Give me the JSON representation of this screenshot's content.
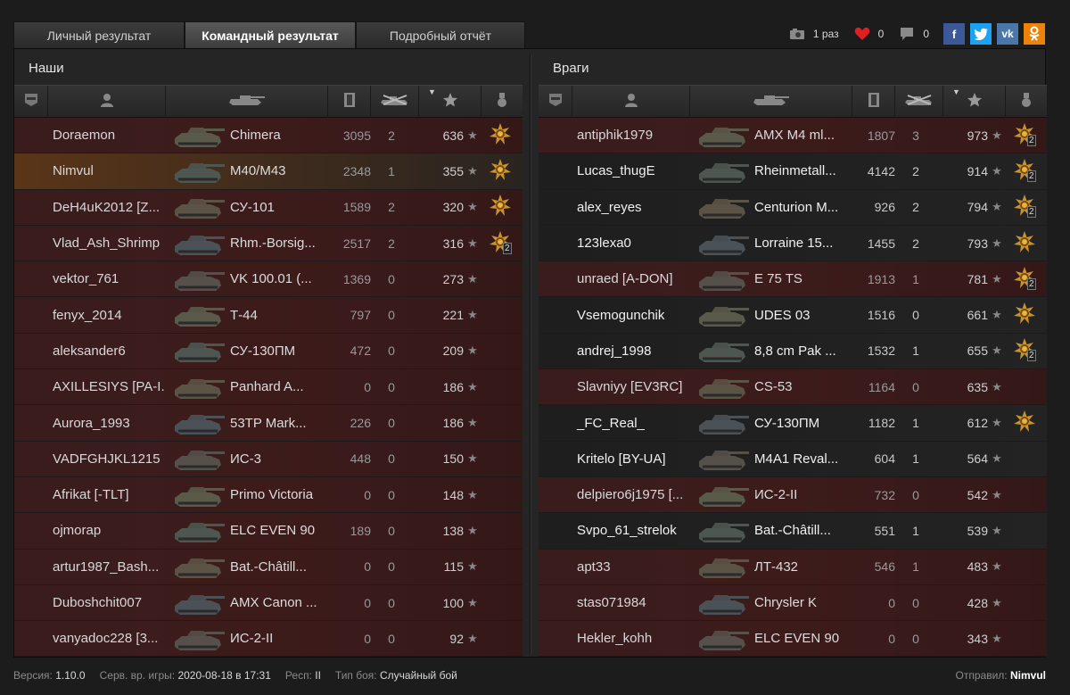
{
  "tabs": [
    {
      "label": "Личный результат",
      "active": false
    },
    {
      "label": "Командный результат",
      "active": true
    },
    {
      "label": "Подробный отчёт",
      "active": false
    }
  ],
  "social": {
    "views": "1 раз",
    "likes": "0",
    "comments": "0",
    "buttons": [
      "facebook",
      "twitter",
      "vk",
      "odnoklassniki"
    ],
    "colors": {
      "facebook": "#3b5998",
      "twitter": "#1da1f2",
      "vk": "#4a76a8",
      "odnoklassniki": "#ee8208"
    }
  },
  "teams": {
    "ours": {
      "title": "Наши",
      "players": [
        {
          "name": "Doraemon",
          "tank": "Chimera",
          "damage": "3095",
          "kills": "2",
          "xp": "636",
          "medal": true,
          "medal_count": "",
          "self": false,
          "alive": false
        },
        {
          "name": "Nimvul",
          "tank": "M40/M43",
          "damage": "2348",
          "kills": "1",
          "xp": "355",
          "medal": true,
          "medal_count": "",
          "self": true,
          "alive": false
        },
        {
          "name": "DeH4uK2012 [Z...",
          "tank": "СУ-101",
          "damage": "1589",
          "kills": "2",
          "xp": "320",
          "medal": true,
          "medal_count": "",
          "self": false,
          "alive": false
        },
        {
          "name": "Vlad_Ash_Shrimp",
          "tank": "Rhm.-Borsig...",
          "damage": "2517",
          "kills": "2",
          "xp": "316",
          "medal": true,
          "medal_count": "2",
          "self": false,
          "alive": false
        },
        {
          "name": "vektor_761",
          "tank": "VK 100.01 (...",
          "damage": "1369",
          "kills": "0",
          "xp": "273",
          "medal": false,
          "medal_count": "",
          "self": false,
          "alive": false
        },
        {
          "name": "fenyx_2014",
          "tank": "Т-44",
          "damage": "797",
          "kills": "0",
          "xp": "221",
          "medal": false,
          "medal_count": "",
          "self": false,
          "alive": false
        },
        {
          "name": "aleksander6",
          "tank": "СУ-130ПМ",
          "damage": "472",
          "kills": "0",
          "xp": "209",
          "medal": false,
          "medal_count": "",
          "self": false,
          "alive": false
        },
        {
          "name": "AXILLESIYS [PA-I...",
          "tank": "Panhard A...",
          "damage": "0",
          "kills": "0",
          "xp": "186",
          "medal": false,
          "medal_count": "",
          "self": false,
          "alive": false
        },
        {
          "name": "Aurora_1993",
          "tank": "53TP Mark...",
          "damage": "226",
          "kills": "0",
          "xp": "186",
          "medal": false,
          "medal_count": "",
          "self": false,
          "alive": false
        },
        {
          "name": "VADFGHJKL1215",
          "tank": "ИС-3",
          "damage": "448",
          "kills": "0",
          "xp": "150",
          "medal": false,
          "medal_count": "",
          "self": false,
          "alive": false
        },
        {
          "name": "Afrikat [-TLT]",
          "tank": "Primo Victoria",
          "damage": "0",
          "kills": "0",
          "xp": "148",
          "medal": false,
          "medal_count": "",
          "self": false,
          "alive": false
        },
        {
          "name": "ojmorap",
          "tank": "ELC EVEN 90",
          "damage": "189",
          "kills": "0",
          "xp": "138",
          "medal": false,
          "medal_count": "",
          "self": false,
          "alive": false
        },
        {
          "name": "artur1987_Bash...",
          "tank": "Bat.-Châtill...",
          "damage": "0",
          "kills": "0",
          "xp": "115",
          "medal": false,
          "medal_count": "",
          "self": false,
          "alive": false
        },
        {
          "name": "Duboshchit007",
          "tank": "AMX Canon ...",
          "damage": "0",
          "kills": "0",
          "xp": "100",
          "medal": false,
          "medal_count": "",
          "self": false,
          "alive": false
        },
        {
          "name": "vanyadoc228 [3...",
          "tank": "ИС-2-II",
          "damage": "0",
          "kills": "0",
          "xp": "92",
          "medal": false,
          "medal_count": "",
          "self": false,
          "alive": false
        }
      ]
    },
    "enemies": {
      "title": "Враги",
      "players": [
        {
          "name": "antiphik1979",
          "tank": "AMX M4 ml...",
          "damage": "1807",
          "kills": "3",
          "xp": "973",
          "medal": true,
          "medal_count": "2",
          "self": false,
          "alive": false
        },
        {
          "name": "Lucas_thugE",
          "tank": "Rheinmetall...",
          "damage": "4142",
          "kills": "2",
          "xp": "914",
          "medal": true,
          "medal_count": "2",
          "self": false,
          "alive": true
        },
        {
          "name": "alex_reyes",
          "tank": "Centurion M...",
          "damage": "926",
          "kills": "2",
          "xp": "794",
          "medal": true,
          "medal_count": "2",
          "self": false,
          "alive": true
        },
        {
          "name": "123lexa0",
          "tank": "Lorraine 15...",
          "damage": "1455",
          "kills": "2",
          "xp": "793",
          "medal": true,
          "medal_count": "",
          "self": false,
          "alive": true
        },
        {
          "name": "unraed [A-DON]",
          "tank": "E 75 TS",
          "damage": "1913",
          "kills": "1",
          "xp": "781",
          "medal": true,
          "medal_count": "2",
          "self": false,
          "alive": false
        },
        {
          "name": "Vsemogunchik",
          "tank": "UDES 03",
          "damage": "1516",
          "kills": "0",
          "xp": "661",
          "medal": true,
          "medal_count": "",
          "self": false,
          "alive": true
        },
        {
          "name": "andrej_1998",
          "tank": "8,8 cm Pak ...",
          "damage": "1532",
          "kills": "1",
          "xp": "655",
          "medal": true,
          "medal_count": "2",
          "self": false,
          "alive": true
        },
        {
          "name": "Slavniyy [EV3RC]",
          "tank": "CS-53",
          "damage": "1164",
          "kills": "0",
          "xp": "635",
          "medal": false,
          "medal_count": "",
          "self": false,
          "alive": false
        },
        {
          "name": "_FC_Real_",
          "tank": "СУ-130ПМ",
          "damage": "1182",
          "kills": "1",
          "xp": "612",
          "medal": true,
          "medal_count": "",
          "self": false,
          "alive": true
        },
        {
          "name": "Kritelo [BY-UA]",
          "tank": "M4A1 Reval...",
          "damage": "604",
          "kills": "1",
          "xp": "564",
          "medal": false,
          "medal_count": "",
          "self": false,
          "alive": true
        },
        {
          "name": "delpiero6j1975 [...",
          "tank": "ИС-2-II",
          "damage": "732",
          "kills": "0",
          "xp": "542",
          "medal": false,
          "medal_count": "",
          "self": false,
          "alive": false
        },
        {
          "name": "Svpo_61_strelok",
          "tank": "Bat.-Châtill...",
          "damage": "551",
          "kills": "1",
          "xp": "539",
          "medal": false,
          "medal_count": "",
          "self": false,
          "alive": true
        },
        {
          "name": "apt33",
          "tank": "ЛТ-432",
          "damage": "546",
          "kills": "1",
          "xp": "483",
          "medal": false,
          "medal_count": "",
          "self": false,
          "alive": false
        },
        {
          "name": "stas071984",
          "tank": "Chrysler K",
          "damage": "0",
          "kills": "0",
          "xp": "428",
          "medal": false,
          "medal_count": "",
          "self": false,
          "alive": false
        },
        {
          "name": "Hekler_kohh",
          "tank": "ELC EVEN 90",
          "damage": "0",
          "kills": "0",
          "xp": "343",
          "medal": false,
          "medal_count": "",
          "self": false,
          "alive": false
        }
      ]
    }
  },
  "footer": {
    "version_label": "Версия:",
    "version": "1.10.0",
    "time_label": "Серв. вр. игры:",
    "time": "2020-08-18 в 17:31",
    "server_label": "Респ:",
    "server": "II",
    "type_label": "Тип боя:",
    "type": "Случайный бой",
    "sender_label": "Отправил:",
    "sender": "Nimvul"
  }
}
